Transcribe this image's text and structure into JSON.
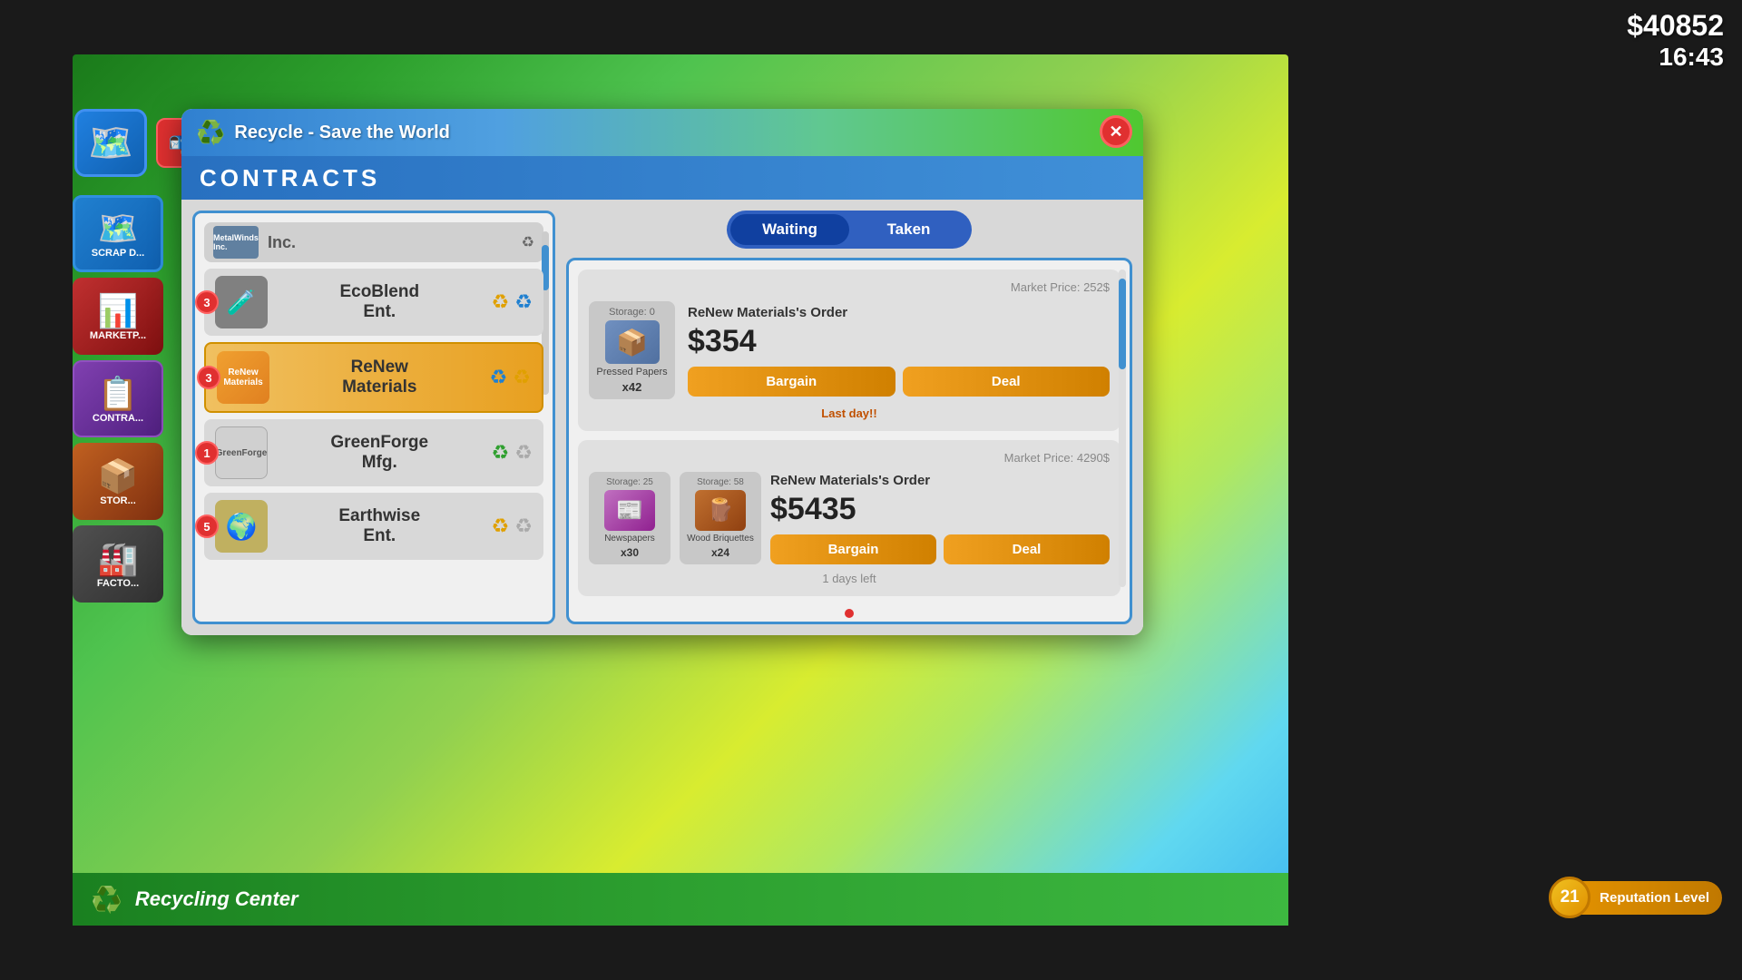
{
  "topbar": {
    "money": "$40852",
    "time": "16:43"
  },
  "window": {
    "title": "Recycle - Save the World",
    "close_label": "✕",
    "section_title": "CONTRACTS"
  },
  "tabs": {
    "waiting": "Waiting",
    "taken": "Taken"
  },
  "companies": [
    {
      "id": "metalwinds",
      "name": "Inc.",
      "badge": null,
      "partial": true,
      "logo_text": "MetalWinds Inc.",
      "selected": false,
      "recycling_icons": []
    },
    {
      "id": "ecoblend",
      "name": "EcoBlend Ent.",
      "badge": "3",
      "selected": false,
      "logo_emoji": "🧪",
      "logo_class": "ecoblend",
      "recycling_icons": [
        "yellow",
        "blue"
      ]
    },
    {
      "id": "renew",
      "name": "ReNew Materials",
      "badge": "3",
      "selected": true,
      "logo_emoji": "🏪",
      "logo_class": "renew",
      "recycling_icons": [
        "blue",
        "yellow"
      ]
    },
    {
      "id": "greenforge",
      "name": "GreenForge Mfg.",
      "badge": "1",
      "selected": false,
      "logo_emoji": "🏭",
      "logo_class": "greenforge",
      "recycling_icons": [
        "green",
        "gray"
      ]
    },
    {
      "id": "earthwise",
      "name": "Earthwise Ent.",
      "badge": "5",
      "selected": false,
      "logo_emoji": "🌍",
      "logo_class": "earthwise",
      "recycling_icons": [
        "yellow",
        "gray"
      ]
    }
  ],
  "orders": [
    {
      "id": "order1",
      "market_price_label": "Market Price: 252$",
      "company_order": "ReNew Materials's Order",
      "price": "$354",
      "deadline": "Last day!!",
      "storage_label": "Storage: 0",
      "items": [
        {
          "name": "Pressed Papers",
          "qty": "x42",
          "storage": "Storage: 0",
          "icon_type": "pressed_papers"
        }
      ],
      "bargain_label": "Bargain",
      "deal_label": "Deal"
    },
    {
      "id": "order2",
      "market_price_label": "Market Price: 4290$",
      "company_order": "ReNew Materials's Order",
      "price": "$5435",
      "deadline": "1 days left",
      "items": [
        {
          "name": "Newspapers",
          "qty": "x30",
          "storage": "Storage: 25",
          "icon_type": "newspapers"
        },
        {
          "name": "Wood Briquettes",
          "qty": "x24",
          "storage": "Storage: 58",
          "icon_type": "wood_briquettes"
        }
      ],
      "bargain_label": "Bargain",
      "deal_label": "Deal"
    }
  ],
  "bottombar": {
    "center_name": "Recycling Center"
  },
  "reputation": {
    "level": "21",
    "label": "Reputation Level"
  },
  "sidebar": {
    "items": [
      {
        "label": "MARKETP...",
        "icon": "📈",
        "class": "nav-market-bg"
      },
      {
        "label": "CONTRA...",
        "icon": "📋",
        "class": "nav-contracts-bg"
      },
      {
        "label": "STOR...",
        "icon": "📦",
        "class": "nav-storage-bg"
      },
      {
        "label": "FACTO...",
        "icon": "🏭",
        "class": "nav-factory-bg"
      }
    ]
  }
}
